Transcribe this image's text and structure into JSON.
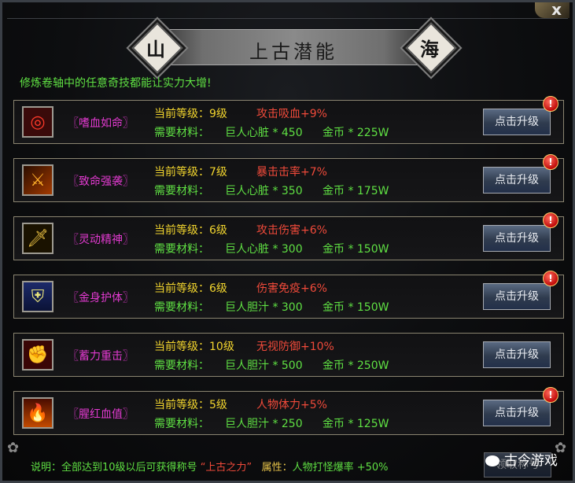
{
  "window": {
    "close_label": "x"
  },
  "title": "上古潜能",
  "badge_left": "山",
  "badge_right": "海",
  "intro": "修炼卷轴中的任意奇技都能让实力大增!",
  "labels": {
    "current_level": "当前等级：",
    "materials": "需要材料：",
    "upgrade_button": "点击升级",
    "alert_badge": "!"
  },
  "skills": [
    {
      "name": "〖嗜血如命〗",
      "level": "9级",
      "effect": "攻击吸血+9%",
      "material": "巨人心脏 * 450",
      "gold": "金币 * 225W",
      "icon": "blood-target-icon"
    },
    {
      "name": "〖致命强袭〗",
      "level": "7级",
      "effect": "暴击击率+7%",
      "material": "巨人心脏 * 350",
      "gold": "金币 * 175W",
      "icon": "flame-slash-icon"
    },
    {
      "name": "〖灵动精神〗",
      "level": "6级",
      "effect": "攻击伤害+6%",
      "material": "巨人心脏 * 300",
      "gold": "金币 * 150W",
      "icon": "golden-sword-icon"
    },
    {
      "name": "〖金身护体〗",
      "level": "6级",
      "effect": "伤害免疫+6%",
      "material": "巨人胆汁 * 300",
      "gold": "金币 * 150W",
      "icon": "shield-icon"
    },
    {
      "name": "〖蓄力重击〗",
      "level": "10级",
      "effect": "无视防御+10%",
      "material": "巨人胆汁 * 500",
      "gold": "金币 * 250W",
      "icon": "red-fist-icon"
    },
    {
      "name": "〖腥红血值〗",
      "level": "5级",
      "effect": "人物体力+5%",
      "material": "巨人胆汁 * 250",
      "gold": "金币 * 125W",
      "icon": "fire-warrior-icon"
    }
  ],
  "footer": {
    "prefix": "说明：全部达到10级以后可获得称号",
    "title_name": "“上古之力”",
    "attr_label": "属性：",
    "attr_value": "人物打怪爆率 +50%"
  },
  "claim_button": "领取称号",
  "watermark": "古今游戏",
  "colors": {
    "skill_name": "#e23ad0",
    "current_level": "#f2d52e",
    "effect": "#f04a3a",
    "material": "#5fe043",
    "button": "#2f3b4e"
  }
}
